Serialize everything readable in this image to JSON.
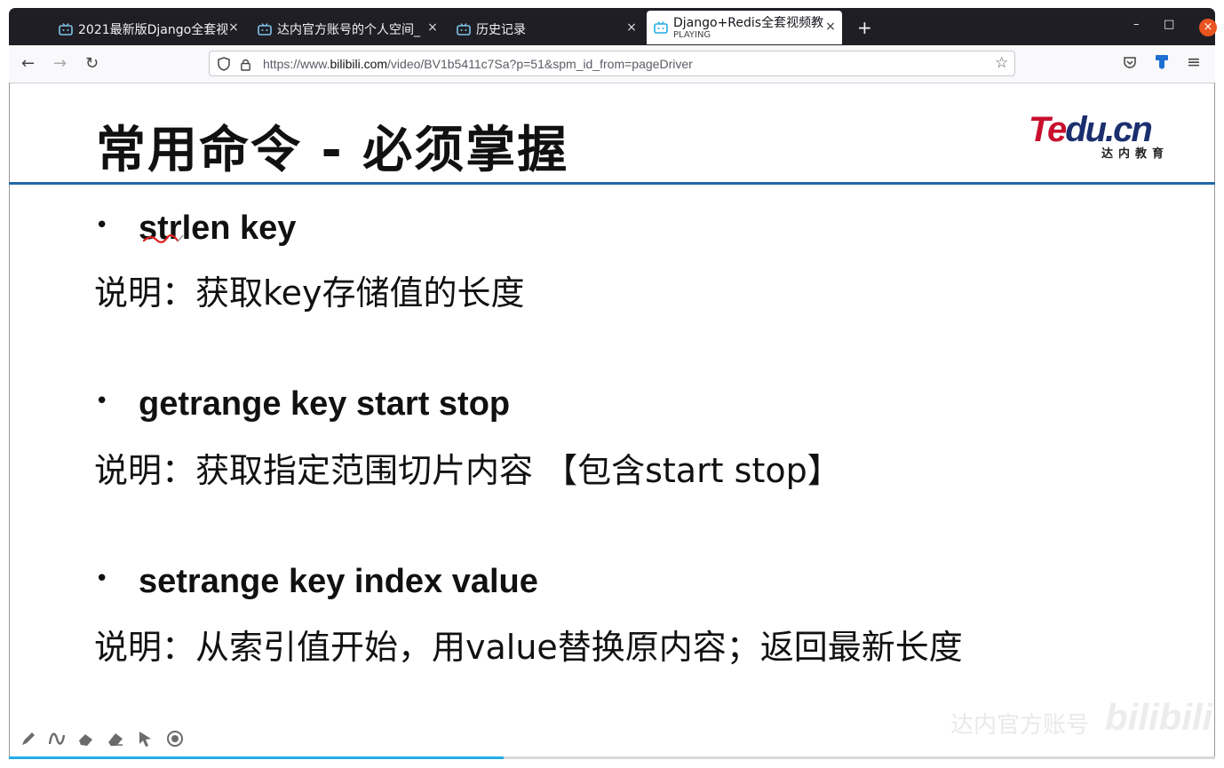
{
  "browser": {
    "tabs": [
      {
        "title": "2021最新版Django全套视",
        "active": false
      },
      {
        "title": "达内官方账号的个人空间_",
        "active": false
      },
      {
        "title": "历史记录",
        "active": false
      },
      {
        "title": "Django+Redis全套视频教",
        "subtitle": "PLAYING",
        "active": true
      }
    ],
    "new_tab_label": "+",
    "close_glyph": "×",
    "url": {
      "prefix": "https://www.",
      "host": "bilibili.com",
      "path": "/video/BV1b5411c7Sa?p=51&spm_id_from=pageDriver"
    },
    "window_controls": {
      "minimize": "–",
      "maximize": "□",
      "close": "×"
    },
    "icons": {
      "back": "←",
      "forward": "→",
      "reload": "↻",
      "star": "☆",
      "menu": "≡"
    }
  },
  "slide": {
    "title": "常用命令 - 必须掌握",
    "logo": {
      "main_red": "Te",
      "main_blue": "du.cn",
      "sub": "达内教育"
    },
    "bullet_glyph": "•",
    "items": [
      {
        "command": "strlen key",
        "description": "说明：获取key存储值的长度"
      },
      {
        "command": "getrange key start stop",
        "description": "说明：获取指定范围切片内容 【包含start stop】"
      },
      {
        "command": "setrange key index value",
        "description": "说明：从索引值开始，用value替换原内容；返回最新长度"
      }
    ]
  },
  "watermark": {
    "text": "达内官方账号",
    "logo": "bilibili"
  },
  "player": {
    "progress": 0.41
  },
  "colors": {
    "accent_rule": "#2266a8",
    "progress": "#23ade5",
    "logo_red": "#c8102e",
    "logo_blue": "#1b2f6e",
    "annotation": "#e02020"
  }
}
